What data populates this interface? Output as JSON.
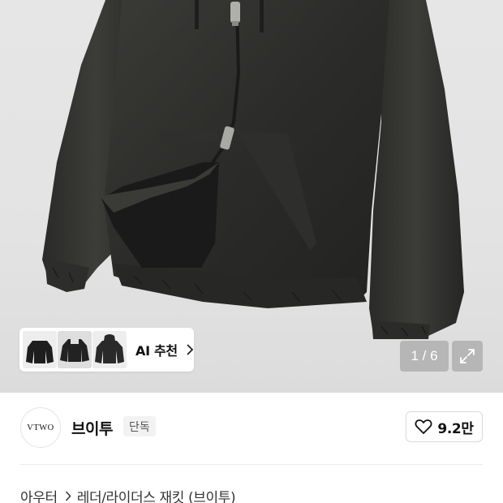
{
  "gallery": {
    "counter_text": "1 / 6",
    "image_alt": "black leather hooded zip-up jacket"
  },
  "ai_recommend": {
    "label": "AI 추천",
    "thumbnails": [
      "jacket-thumb-1",
      "jacket-thumb-2",
      "jacket-thumb-3"
    ]
  },
  "brand": {
    "logo_text": "VTWO",
    "name": "브이투",
    "badge": "단독"
  },
  "like": {
    "count": "9.2만",
    "icon": "heart-outline-icon"
  },
  "breadcrumb": {
    "items": [
      "아우터",
      "레더/라이더스 재킷 (브이투)"
    ]
  },
  "colors": {
    "overlay_bg": "#969696",
    "badge_bg": "#f2f2f2",
    "border": "#d8d8d8"
  }
}
